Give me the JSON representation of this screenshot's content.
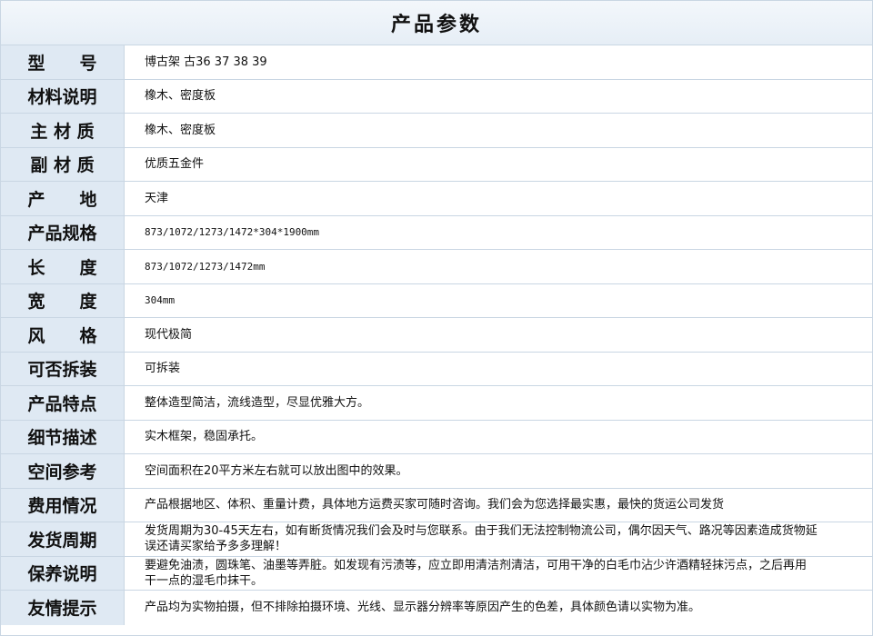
{
  "title": "产品参数",
  "rows": [
    {
      "label": "型　　号",
      "value": "博古架 古36 37 38 39"
    },
    {
      "label": "材料说明",
      "value": "橡木、密度板"
    },
    {
      "label": "主 材 质",
      "value": "橡木、密度板"
    },
    {
      "label": "副 材 质",
      "value": "优质五金件"
    },
    {
      "label": "产　　地",
      "value": "天津"
    },
    {
      "label": "产品规格",
      "value": "873/1072/1273/1472*304*1900mm"
    },
    {
      "label": "长　　度",
      "value": "873/1072/1273/1472mm"
    },
    {
      "label": "宽　　度",
      "value": "304mm"
    },
    {
      "label": "风　　格",
      "value": "现代极简"
    },
    {
      "label": "可否拆装",
      "value": "可拆装"
    },
    {
      "label": "产品特点",
      "value": "整体造型简洁，流线造型，尽显优雅大方。"
    },
    {
      "label": "细节描述",
      "value": "实木框架，稳固承托。"
    },
    {
      "label": "空间参考",
      "value": "空间面积在20平方米左右就可以放出图中的效果。"
    },
    {
      "label": "费用情况",
      "value": "产品根据地区、体积、重量计费，具体地方运费买家可随时咨询。我们会为您选择最实惠，最快的货运公司发货"
    },
    {
      "label": "发货周期",
      "value": "发货周期为30-45天左右，如有断货情况我们会及时与您联系。由于我们无法控制物流公司，偶尔因天气、路况等因素造成货物延误还请买家给予多多理解！"
    },
    {
      "label": "保养说明",
      "value": "要避免油渍，圆珠笔、油墨等弄脏。如发现有污渍等，应立即用清洁剂清洁，可用干净的白毛巾沾少许酒精轻抹污点，之后再用干一点的湿毛巾抹干。"
    },
    {
      "label": "友情提示",
      "value": "产品均为实物拍摄，但不排除拍摄环境、光线、显示器分辨率等原因产生的色差，具体颜色请以实物为准。"
    }
  ]
}
